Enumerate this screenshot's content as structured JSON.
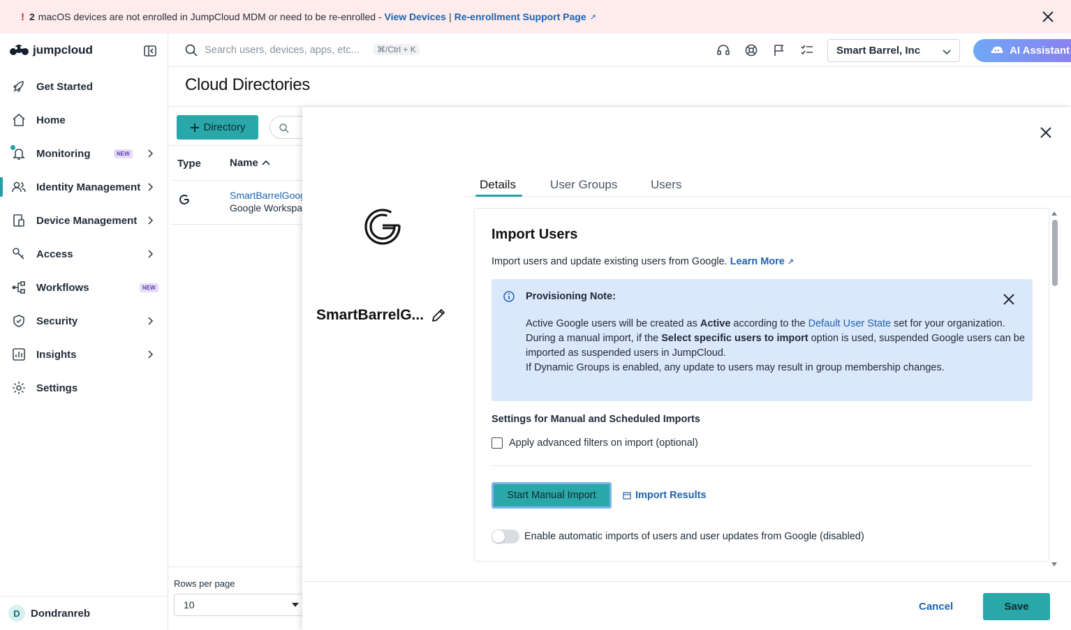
{
  "banner": {
    "bang": "!",
    "count": "2",
    "message": "macOS devices are not enrolled in JumpCloud MDM or need to be re-enrolled -",
    "view_devices": "View Devices",
    "separator": "|",
    "support_link": "Re-enrollment Support Page"
  },
  "brand": {
    "name": "jumpcloud"
  },
  "sidebar": {
    "items": [
      {
        "label": "Get Started",
        "icon": "rocket-icon"
      },
      {
        "label": "Home",
        "icon": "home-icon"
      },
      {
        "label": "Monitoring",
        "icon": "bell-icon",
        "badge": "NEW"
      },
      {
        "label": "Identity Management",
        "icon": "users-icon"
      },
      {
        "label": "Device Management",
        "icon": "device-icon"
      },
      {
        "label": "Access",
        "icon": "key-icon"
      },
      {
        "label": "Workflows",
        "icon": "workflow-icon",
        "badge": "NEW"
      },
      {
        "label": "Security",
        "icon": "shield-icon"
      },
      {
        "label": "Insights",
        "icon": "chart-icon"
      },
      {
        "label": "Settings",
        "icon": "gear-icon"
      }
    ],
    "user": {
      "initial": "D",
      "name": "Dondranreb"
    }
  },
  "topbar": {
    "search_placeholder": "Search users, devices, apps, etc...",
    "shortcut": "⌘/Ctrl + K",
    "org": "Smart Barrel, Inc",
    "ai_label": "AI Assistant"
  },
  "page": {
    "title": "Cloud Directories",
    "add_button": "Directory",
    "columns": {
      "type": "Type",
      "name": "Name"
    },
    "rows": [
      {
        "name": "SmartBarrelGoogle",
        "type_label": "Google Workspace"
      }
    ],
    "rows_per_page_label": "Rows per page",
    "rows_per_page": "10"
  },
  "drawer": {
    "directory_name": "SmartBarrelG...",
    "tabs": [
      "Details",
      "User Groups",
      "Users"
    ],
    "active_tab": "Details",
    "section_title": "Import Users",
    "description": "Import users and update existing users from Google.",
    "learn_more": "Learn More",
    "note": {
      "title": "Provisioning Note:",
      "p1_a": "Active Google users will be created as",
      "p1_bold": "Active",
      "p1_b": "according to the",
      "p1_link": "Default User State",
      "p1_c": "set for your organization.",
      "p2_a": "During a manual import, if the",
      "p2_bold": "Select specific users to import",
      "p2_b": "option is used, suspended Google users can be imported as suspended users in JumpCloud.",
      "p3": "If Dynamic Groups is enabled, any update to users may result in group membership changes."
    },
    "settings_heading": "Settings for Manual and Scheduled Imports",
    "advanced_filters_label": "Apply advanced filters on import (optional)",
    "start_import": "Start Manual Import",
    "import_results": "Import Results",
    "auto_import_label": "Enable automatic imports of users and user updates from Google (disabled)",
    "cancel": "Cancel",
    "save": "Save"
  },
  "colors": {
    "accent": "#2aa7a8",
    "link": "#1d63b0",
    "banner_bg": "#fdeceb",
    "note_bg": "#dbe8fb"
  }
}
